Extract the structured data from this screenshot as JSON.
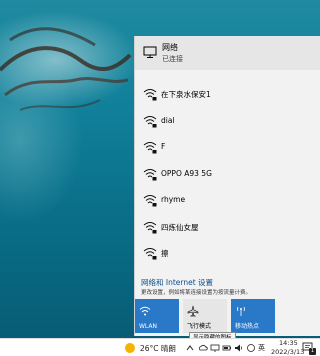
{
  "connected_network": {
    "name": "网络",
    "status": "已连接",
    "icon": "ethernet-monitor-icon"
  },
  "wifi_networks": [
    {
      "name": "在下泉水保安1",
      "icon": "wifi-secured-icon"
    },
    {
      "name": "dial",
      "icon": "wifi-secured-icon"
    },
    {
      "name": "F",
      "icon": "wifi-secured-icon"
    },
    {
      "name": "OPPO A93 5G",
      "icon": "wifi-secured-icon"
    },
    {
      "name": "rhyme",
      "icon": "wifi-secured-icon"
    },
    {
      "name": "四炼仙女屋",
      "icon": "wifi-secured-icon"
    },
    {
      "name": "擦",
      "icon": "wifi-secured-icon"
    }
  ],
  "settings": {
    "title": "网络和 Internet 设置",
    "description": "更改设置，例如将某连接设置为按流量计费。"
  },
  "quick_tiles": [
    {
      "label": "WLAN",
      "icon": "wifi-icon",
      "active": true
    },
    {
      "label": "飞行模式",
      "icon": "airplane-icon",
      "active": false
    },
    {
      "label": "移动热点",
      "icon": "hotspot-icon",
      "active": true
    }
  ],
  "tooltip": "显示隐藏的图标",
  "taskbar": {
    "weather": "26°C 晴朗",
    "ime": "英",
    "time": "14:35",
    "date": "2022/3/13",
    "notification_count": "1"
  },
  "colors": {
    "accent": "#2a78c8",
    "link": "#0b4f8c",
    "flyout_bg": "#f2f2f2"
  }
}
